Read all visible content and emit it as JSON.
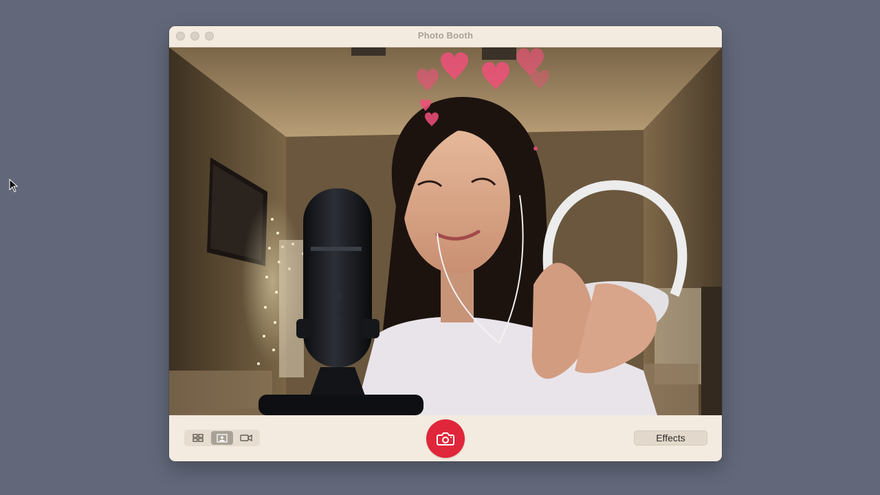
{
  "window": {
    "title": "Photo Booth"
  },
  "toolbar": {
    "modes": [
      {
        "icon": "four-up-grid-icon",
        "name": "Take four quick pictures"
      },
      {
        "icon": "single-photo-icon",
        "name": "Take a still picture",
        "selected": true
      },
      {
        "icon": "video-camera-icon",
        "name": "Record a movie clip"
      }
    ],
    "shutter_icon": "camera-icon",
    "effects_label": "Effects"
  },
  "colors": {
    "desktop": "#62687a",
    "window_chrome": "#f3ebdf",
    "shutter": "#e0263a",
    "hearts": "#f0507a"
  }
}
